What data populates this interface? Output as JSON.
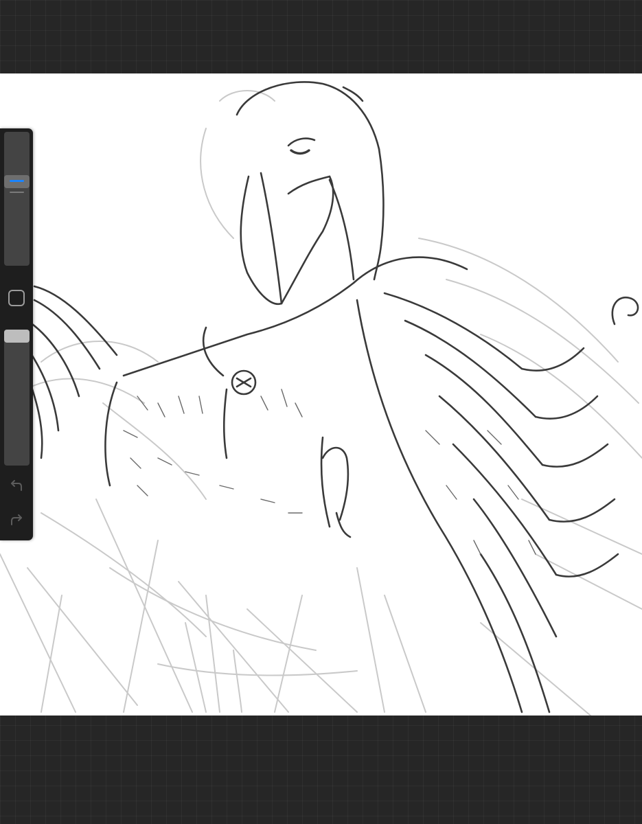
{
  "app": {
    "background_color": "#262626",
    "canvas_color": "#ffffff",
    "accent_color": "#1a84ff"
  },
  "sidebar": {
    "brush_size": {
      "control": "brush-size-slider",
      "level_fraction": 0.64
    },
    "modify_button": {
      "icon": "square-icon"
    },
    "opacity": {
      "control": "opacity-slider",
      "level_fraction": 1.0
    },
    "undo": {
      "icon": "undo-icon"
    },
    "redo": {
      "icon": "redo-icon"
    }
  },
  "canvas": {
    "content": "sketch-illustration"
  }
}
